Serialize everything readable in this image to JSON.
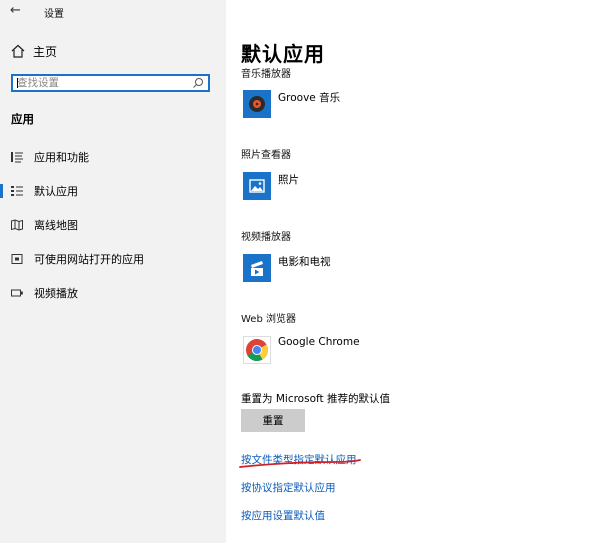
{
  "window": {
    "title": "设置"
  },
  "sidebar": {
    "home_label": "主页",
    "search_placeholder": "查找设置",
    "section_title": "应用",
    "items": [
      {
        "label": "应用和功能",
        "icon": "list-icon"
      },
      {
        "label": "默认应用",
        "icon": "default-apps-icon",
        "selected": true
      },
      {
        "label": "离线地图",
        "icon": "map-icon"
      },
      {
        "label": "可使用网站打开的应用",
        "icon": "website-app-icon"
      },
      {
        "label": "视频播放",
        "icon": "video-icon"
      }
    ]
  },
  "main": {
    "title": "默认应用",
    "categories": [
      {
        "label": "音乐播放器",
        "app": "Groove 音乐",
        "icon": "groove-music-icon"
      },
      {
        "label": "照片查看器",
        "app": "照片",
        "icon": "photos-icon"
      },
      {
        "label": "视频播放器",
        "app": "电影和电视",
        "icon": "movies-tv-icon"
      },
      {
        "label": "Web 浏览器",
        "app": "Google Chrome",
        "icon": "chrome-icon"
      }
    ],
    "reset_label": "重置为 Microsoft 推荐的默认值",
    "reset_button": "重置",
    "links": [
      "按文件类型指定默认应用",
      "按协议指定默认应用",
      "按应用设置默认值"
    ]
  },
  "colors": {
    "accent": "#1a73c9",
    "link": "#0a5cba",
    "sidebar_bg": "#f2f2f2",
    "annotation": "#d0202a"
  }
}
